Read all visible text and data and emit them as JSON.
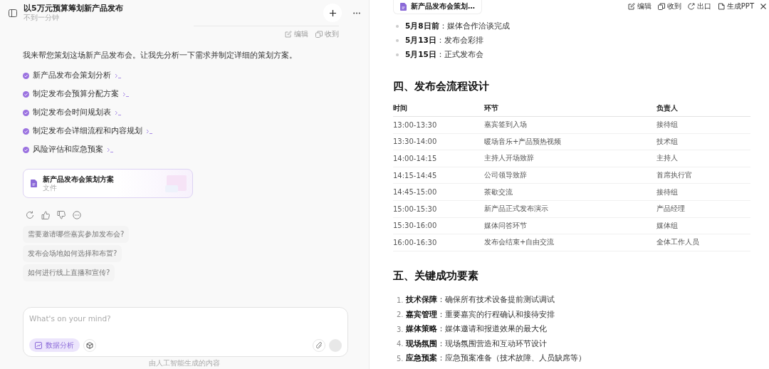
{
  "chat": {
    "title": "以5万元预算筹划新产品发布",
    "subtitle": "不到一分钟",
    "actions": [
      "编辑",
      "收到"
    ],
    "intro": "我来帮您策划这场新产品发布会。让我先分析一下需求并制定详细的策划方案。",
    "steps": [
      {
        "label": "新产品发布会策划分析",
        "done": true
      },
      {
        "label": "制定发布会预算分配方案",
        "done": true
      },
      {
        "label": "制定发布会时间规划表",
        "done": true
      },
      {
        "label": "制定发布会详细流程和内容规划",
        "done": true
      },
      {
        "label": "风险评估和应急预案",
        "done": true
      }
    ],
    "file": {
      "name": "新产品发布会策划方案",
      "type": "文件"
    },
    "suggestions": [
      "需要邀请哪些嘉宾参加发布会?",
      "发布会场地如何选择和布置?",
      "如何进行线上直播和宣传?"
    ],
    "input": {
      "placeholder": "What's on your mind?"
    },
    "tools": [
      {
        "label": "数据分析",
        "selected": true
      }
    ],
    "footer": "由人工智能生成的内容"
  },
  "document": {
    "tab": "新产品发布会策划…",
    "toolbar": [
      "编辑",
      "收到",
      "出口",
      "生成PPT"
    ],
    "milestones": [
      "**5月8日前**：媒体合作洽谈完成",
      "**5月13日**：发布会彩排",
      "**5月15日**：正式发布会"
    ],
    "sections": [
      {
        "heading": "四、发布会流程设计",
        "table": {
          "columns": [
            "时间",
            "环节",
            "负责人"
          ],
          "rows": [
            [
              "13:00-13:30",
              "嘉宾签到入场",
              "接待组"
            ],
            [
              "13:30-14:00",
              "暖场音乐+产品预热视频",
              "技术组"
            ],
            [
              "14:00-14:15",
              "主持人开场致辞",
              "主持人"
            ],
            [
              "14:15-14:45",
              "公司领导致辞",
              "首席执行官"
            ],
            [
              "14:45-15:00",
              "茶歇交流",
              "接待组"
            ],
            [
              "15:00-15:30",
              "新产品正式发布演示",
              "产品经理"
            ],
            [
              "15:30-16:00",
              "媒体问答环节",
              "媒体组"
            ],
            [
              "16:00-16:30",
              "发布会结束+自由交流",
              "全体工作人员"
            ]
          ]
        }
      },
      {
        "heading": "五、关键成功要素",
        "items": [
          {
            "number": "1.",
            "text": "**技术保障**：确保所有技术设备提前测试调试"
          },
          {
            "number": "2.",
            "text": "**嘉宾管理**：重要嘉宾的行程确认和接待安排"
          },
          {
            "number": "3.",
            "text": "**媒体策略**：媒体邀请和报道效果的最大化"
          },
          {
            "number": "4.",
            "text": "**现场氛围**：现场氛围营造和互动环节设计"
          },
          {
            "number": "5.",
            "text": "**应急预案**：应急预案准备（技术故障、人员缺席等）"
          }
        ]
      }
    ]
  }
}
